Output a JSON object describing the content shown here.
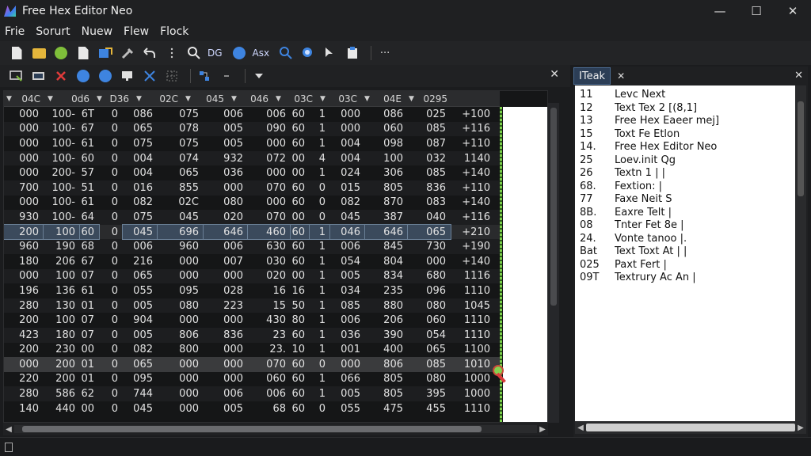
{
  "window": {
    "title": "Free Hex Editor Neo",
    "minimize": "—",
    "maximize": "☐",
    "close": "✕"
  },
  "menu": [
    "Frie",
    "Sorurt",
    "Nuew",
    "Flew",
    "Flock"
  ],
  "toolbar1": {
    "text1": "DG",
    "text2": "Asx",
    "more": "···"
  },
  "toolbar2": {
    "close": "✕"
  },
  "hex": {
    "headers": [
      "04C",
      "0d6",
      "D36",
      "02C",
      "045",
      "046",
      "03C",
      "03C",
      "04E",
      "0295"
    ],
    "rows": [
      [
        "000",
        "100-",
        "6T",
        "0",
        "086",
        "075",
        "006",
        "006",
        "60",
        "1",
        "000",
        "086",
        "025",
        "+100"
      ],
      [
        "000",
        "100-",
        "67",
        "0",
        "065",
        "078",
        "005",
        "090",
        "60",
        "1",
        "000",
        "060",
        "085",
        "+116"
      ],
      [
        "000",
        "100-",
        "61",
        "0",
        "075",
        "075",
        "005",
        "000",
        "60",
        "1",
        "004",
        "098",
        "087",
        "+110"
      ],
      [
        "000",
        "100-",
        "60",
        "0",
        "004",
        "074",
        "932",
        "072",
        "00",
        "4",
        "004",
        "100",
        "032",
        "1140"
      ],
      [
        "000",
        "200-",
        "57",
        "0",
        "004",
        "065",
        "036",
        "000",
        "00",
        "1",
        "024",
        "306",
        "085",
        "+140"
      ],
      [
        "700",
        "100-",
        "51",
        "0",
        "016",
        "855",
        "000",
        "070",
        "60",
        "0",
        "015",
        "805",
        "836",
        "+110"
      ],
      [
        "000",
        "100-",
        "61",
        "0",
        "082",
        "02C",
        "080",
        "000",
        "60",
        "0",
        "082",
        "870",
        "083",
        "+140"
      ],
      [
        "930",
        "100-",
        "64",
        "0",
        "075",
        "045",
        "020",
        "070",
        "00",
        "0",
        "045",
        "387",
        "040",
        "+116"
      ],
      [
        "200",
        "100",
        "60",
        "0",
        "045",
        "696",
        "646",
        "460",
        "60",
        "1",
        "046",
        "646",
        "065",
        "+210"
      ],
      [
        "960",
        "190",
        "68",
        "0",
        "006",
        "960",
        "006",
        "630",
        "60",
        "1",
        "006",
        "845",
        "730",
        "+190"
      ],
      [
        "180",
        "206",
        "67",
        "0",
        "216",
        "000",
        "007",
        "030",
        "60",
        "1",
        "054",
        "804",
        "000",
        "+140"
      ],
      [
        "000",
        "100",
        "07",
        "0",
        "065",
        "000",
        "000",
        "020",
        "00",
        "1",
        "005",
        "834",
        "680",
        "1116"
      ],
      [
        "196",
        "136",
        "61",
        "0",
        "055",
        "095",
        "028",
        "16",
        "16",
        "1",
        "034",
        "235",
        "096",
        "1110"
      ],
      [
        "280",
        "130",
        "01",
        "0",
        "005",
        "080",
        "223",
        "15",
        "50",
        "1",
        "085",
        "880",
        "080",
        "1045"
      ],
      [
        "200",
        "100",
        "07",
        "0",
        "904",
        "000",
        "000",
        "430",
        "80",
        "1",
        "006",
        "206",
        "060",
        "1110"
      ],
      [
        "423",
        "180",
        "07",
        "0",
        "005",
        "806",
        "836",
        "23",
        "60",
        "1",
        "036",
        "390",
        "054",
        "1110"
      ],
      [
        "200",
        "230",
        "00",
        "0",
        "082",
        "800",
        "000",
        "23.",
        "10",
        "1",
        "001",
        "400",
        "065",
        "1100"
      ],
      [
        "000",
        "200",
        "01",
        "0",
        "065",
        "000",
        "000",
        "070",
        "60",
        "0",
        "000",
        "806",
        "085",
        "1010"
      ],
      [
        "220",
        "200",
        "01",
        "0",
        "095",
        "000",
        "000",
        "060",
        "60",
        "1",
        "066",
        "805",
        "080",
        "1000"
      ],
      [
        "280",
        "586",
        "62",
        "0",
        "744",
        "000",
        "006",
        "006",
        "60",
        "1",
        "005",
        "805",
        "395",
        "1000"
      ],
      [
        "140",
        "440",
        "00",
        "0",
        "045",
        "000",
        "005",
        "68",
        "60",
        "0",
        "055",
        "475",
        "455",
        "1110"
      ]
    ]
  },
  "right_panel": {
    "tab_label": "ITeak",
    "tab_close": "✕",
    "panel_close": "✕",
    "lines": [
      {
        "num": "11",
        "text": "Levc Next"
      },
      {
        "num": "12",
        "text": "Text Tex 2    [(8,1]"
      },
      {
        "num": "13",
        "text": "Free Hex Eaeer mej]"
      },
      {
        "num": "15",
        "text": "Toxt Fe Etlon"
      },
      {
        "num": "14.",
        "text": "Free Hex Editor Neo"
      },
      {
        "num": "25",
        "text": "Loev.init Qg"
      },
      {
        "num": "26",
        "text": "Textn 1     |  |"
      },
      {
        "num": "68.",
        "text": "Fextion:     |"
      },
      {
        "num": "77",
        "text": "Faxe Neit S"
      },
      {
        "num": "8B.",
        "text": "Eaxre Telt    |"
      },
      {
        "num": "08",
        "text": "Tnter Fet 8e   |"
      },
      {
        "num": "24.",
        "text": "Vonte tanoo     |."
      },
      {
        "num": "Bat",
        "text": "Text Toxt At    |  |"
      },
      {
        "num": "025",
        "text": "Paxt Fert    |"
      },
      {
        "num": "09T",
        "text": "Textrury Ac An |"
      }
    ]
  }
}
